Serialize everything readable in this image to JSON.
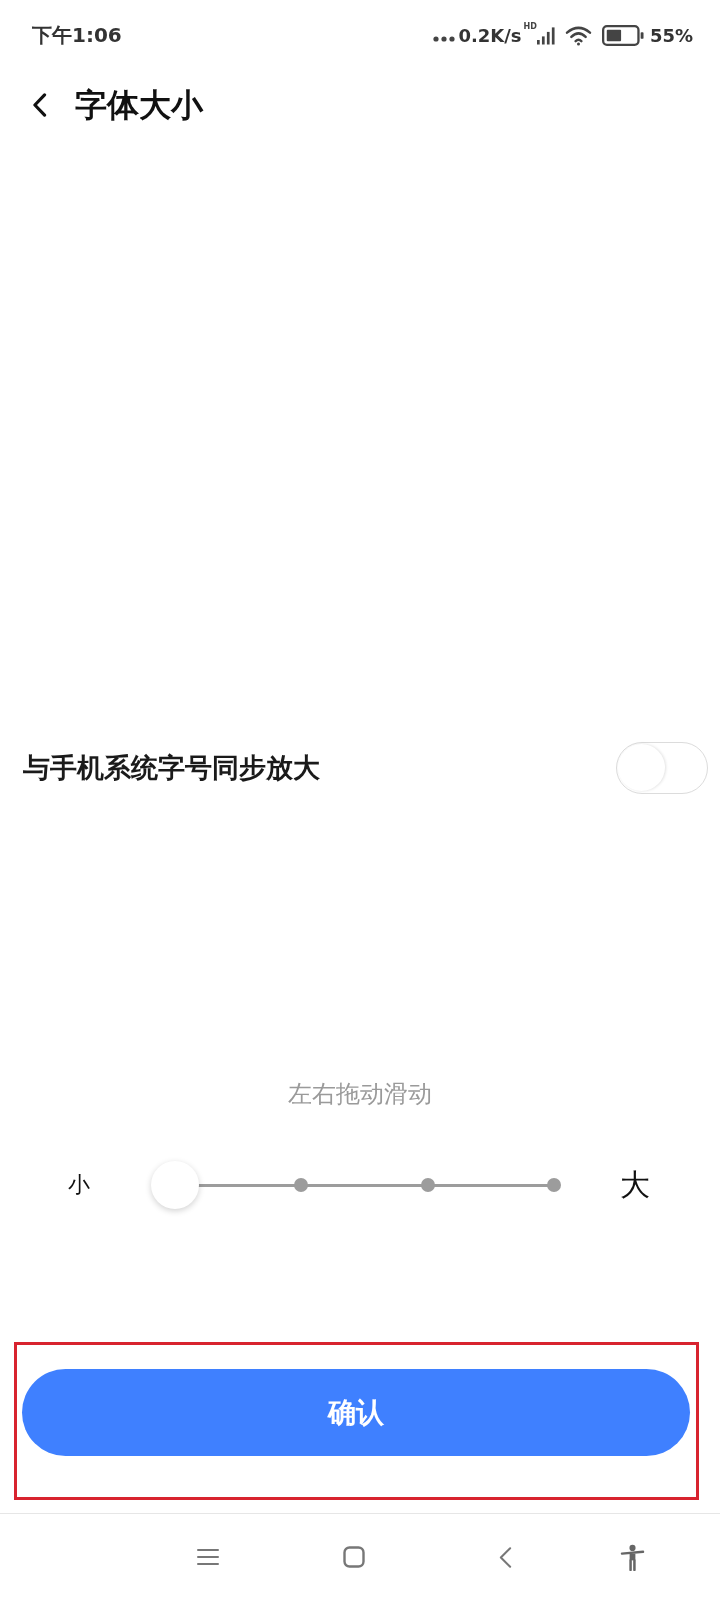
{
  "status_bar": {
    "time": "下午1:06",
    "network_speed": "0.2K/s",
    "network_type": "HD",
    "battery": "55%"
  },
  "header": {
    "title": "字体大小"
  },
  "sync_setting": {
    "label": "与手机系统字号同步放大",
    "on": false
  },
  "font_size_slider": {
    "hint": "左右拖动滑动",
    "min_label": "小",
    "max_label": "大",
    "level": 0
  },
  "confirm_button": {
    "label": "确认"
  }
}
